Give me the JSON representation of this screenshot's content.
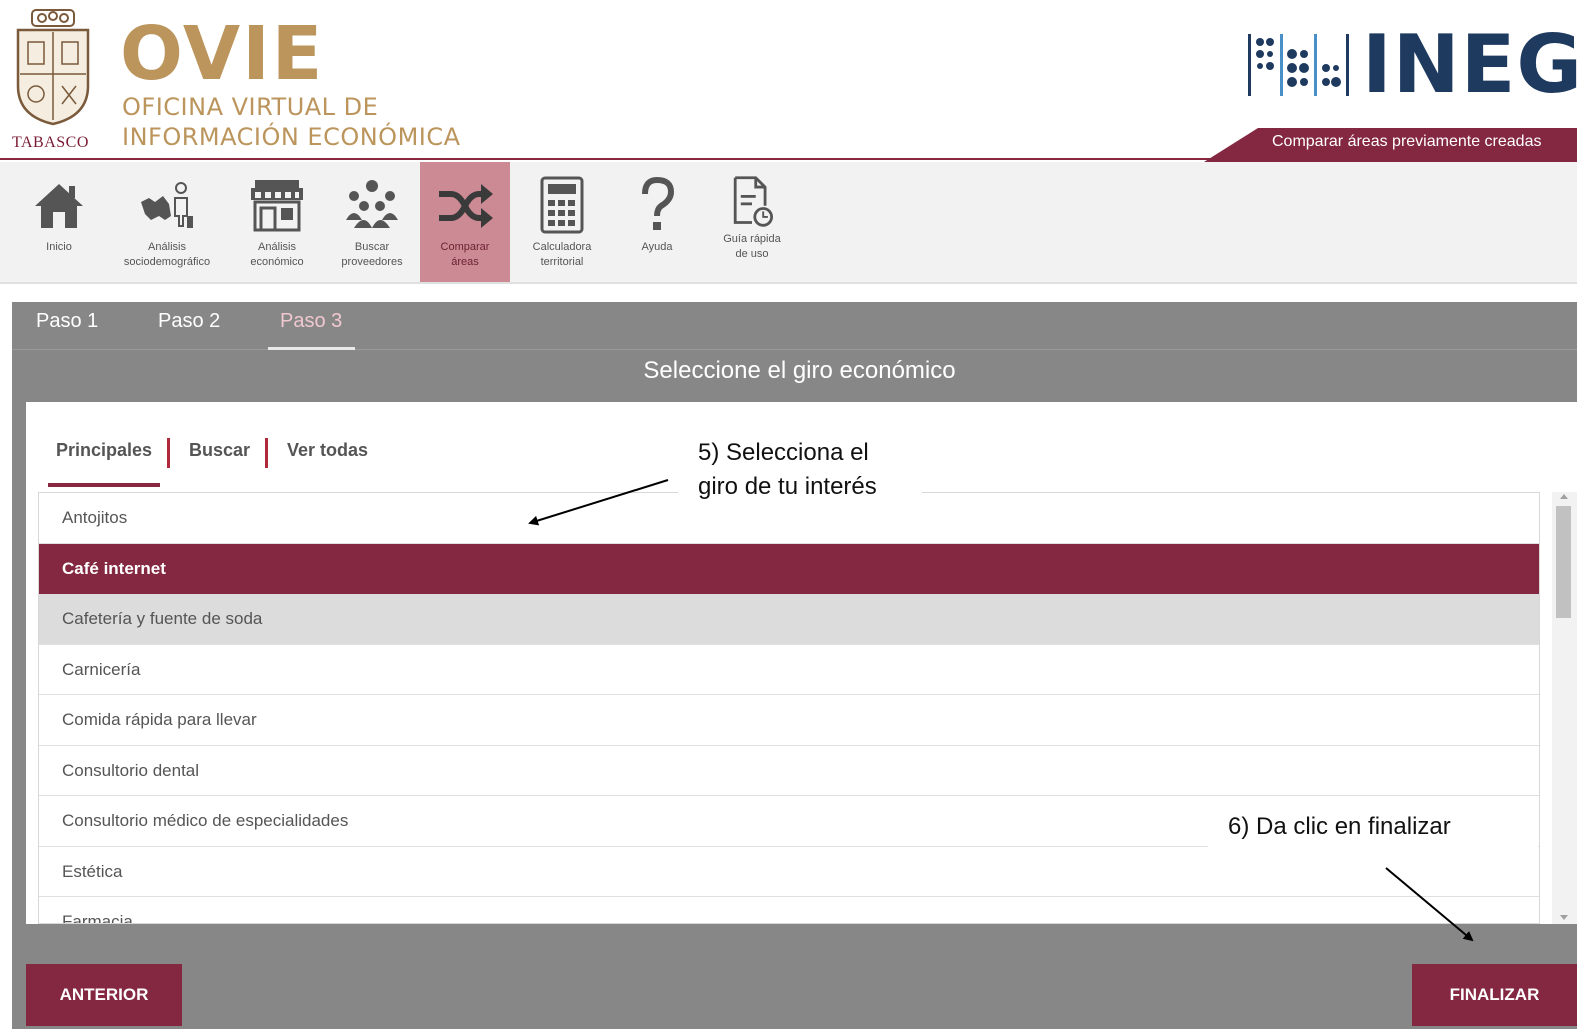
{
  "header": {
    "crest_label": "TABASCO",
    "brand_title": "OVIE",
    "brand_subtitle_line1": "OFICINA VIRTUAL DE",
    "brand_subtitle_line2": "INFORMACIÓN ECONÓMICA",
    "partner_logo_text": "INEGI",
    "banner_text": "Comparar áreas previamente creadas"
  },
  "toolbar": {
    "items": [
      {
        "label_line1": "Inicio",
        "label_line2": "",
        "icon": "home-icon"
      },
      {
        "label_line1": "Análisis",
        "label_line2": "sociodemográfico",
        "icon": "map-person-icon"
      },
      {
        "label_line1": "Análisis",
        "label_line2": "económico",
        "icon": "store-icon"
      },
      {
        "label_line1": "Buscar",
        "label_line2": "proveedores",
        "icon": "people-icon"
      },
      {
        "label_line1": "Comparar",
        "label_line2": "áreas",
        "icon": "shuffle-icon"
      },
      {
        "label_line1": "Calculadora",
        "label_line2": "territorial",
        "icon": "calculator-icon"
      },
      {
        "label_line1": "Ayuda",
        "label_line2": "",
        "icon": "help-icon"
      },
      {
        "label_line1": "Guía rápida",
        "label_line2": "de uso",
        "icon": "guide-document-icon"
      }
    ],
    "active_index": 4
  },
  "steps": {
    "items": [
      "Paso 1",
      "Paso 2",
      "Paso 3"
    ],
    "active_index": 2
  },
  "panel": {
    "title": "Seleccione el giro económico"
  },
  "subtabs": {
    "items": [
      "Principales",
      "Buscar",
      "Ver todas"
    ],
    "active_index": 0
  },
  "giros": {
    "items": [
      "Antojitos",
      "Café internet",
      "Cafetería y fuente de soda",
      "Carnicería",
      "Comida rápida para llevar",
      "Consultorio dental",
      "Consultorio médico de especialidades",
      "Estética",
      "Farmacia"
    ],
    "selected_index": 1,
    "hover_index": 2
  },
  "buttons": {
    "previous": "ANTERIOR",
    "finish": "FINALIZAR"
  },
  "annotations": {
    "step5_line1": "5) Selecciona el",
    "step5_line2": "giro de tu interés",
    "step6": "6) Da clic en finalizar"
  },
  "colors": {
    "brand_gold": "#bc955c",
    "brand_maroon": "#842741",
    "panel_gray": "#878787",
    "inegi_navy": "#1e3a5f"
  }
}
